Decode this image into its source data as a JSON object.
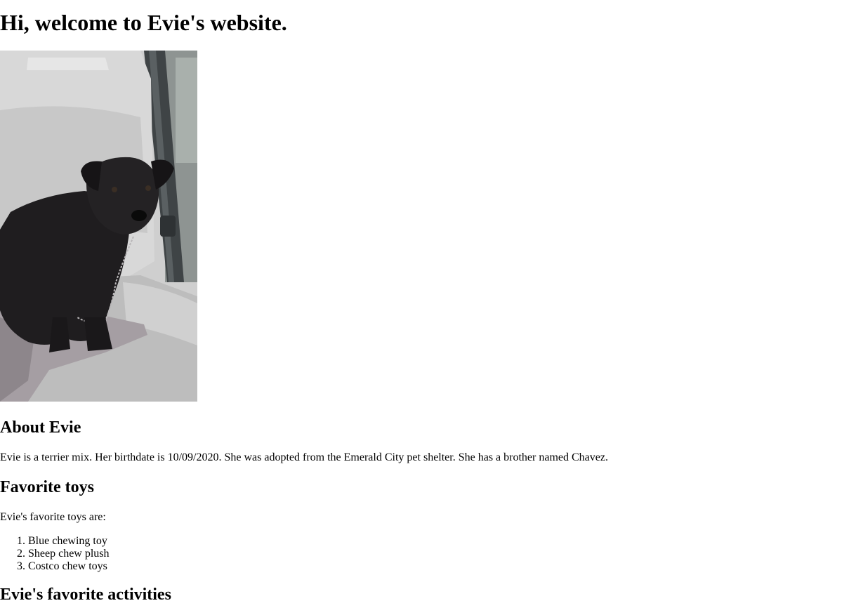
{
  "page": {
    "title": "Hi, welcome to Evie's website."
  },
  "photo": {
    "alt": "Evie, a small black terrier mix, sitting on a car seat"
  },
  "about": {
    "heading": "About Evie",
    "text": "Evie is a terrier mix. Her birthdate is 10/09/2020. She was adopted from the Emerald City pet shelter. She has a brother named Chavez."
  },
  "toys": {
    "heading": "Favorite toys",
    "intro": "Evie's favorite toys are:",
    "items": [
      "Blue chewing toy",
      "Sheep chew plush",
      "Costco chew toys"
    ]
  },
  "activities": {
    "heading": "Evie's favorite activities"
  },
  "colors": {
    "text": "#000000",
    "background": "#ffffff"
  }
}
